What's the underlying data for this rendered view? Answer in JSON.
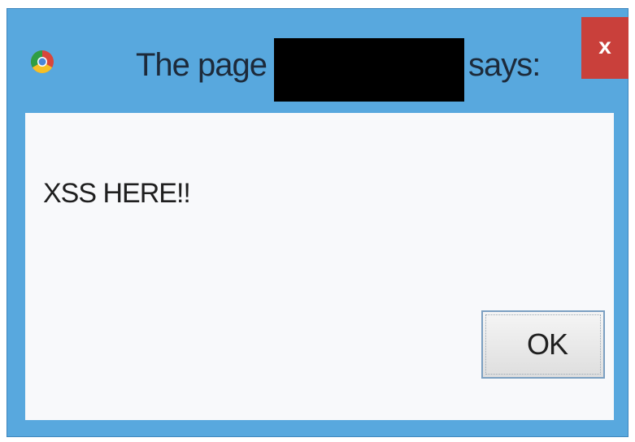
{
  "dialog": {
    "icon": "chrome-icon",
    "title_prefix": "The page at",
    "title_suffix": "says:",
    "close_label": "x",
    "message": "XSS HERE!!",
    "ok_label": "OK"
  },
  "colors": {
    "frame": "#58a8de",
    "close": "#c9403b",
    "redaction": "#000000"
  }
}
